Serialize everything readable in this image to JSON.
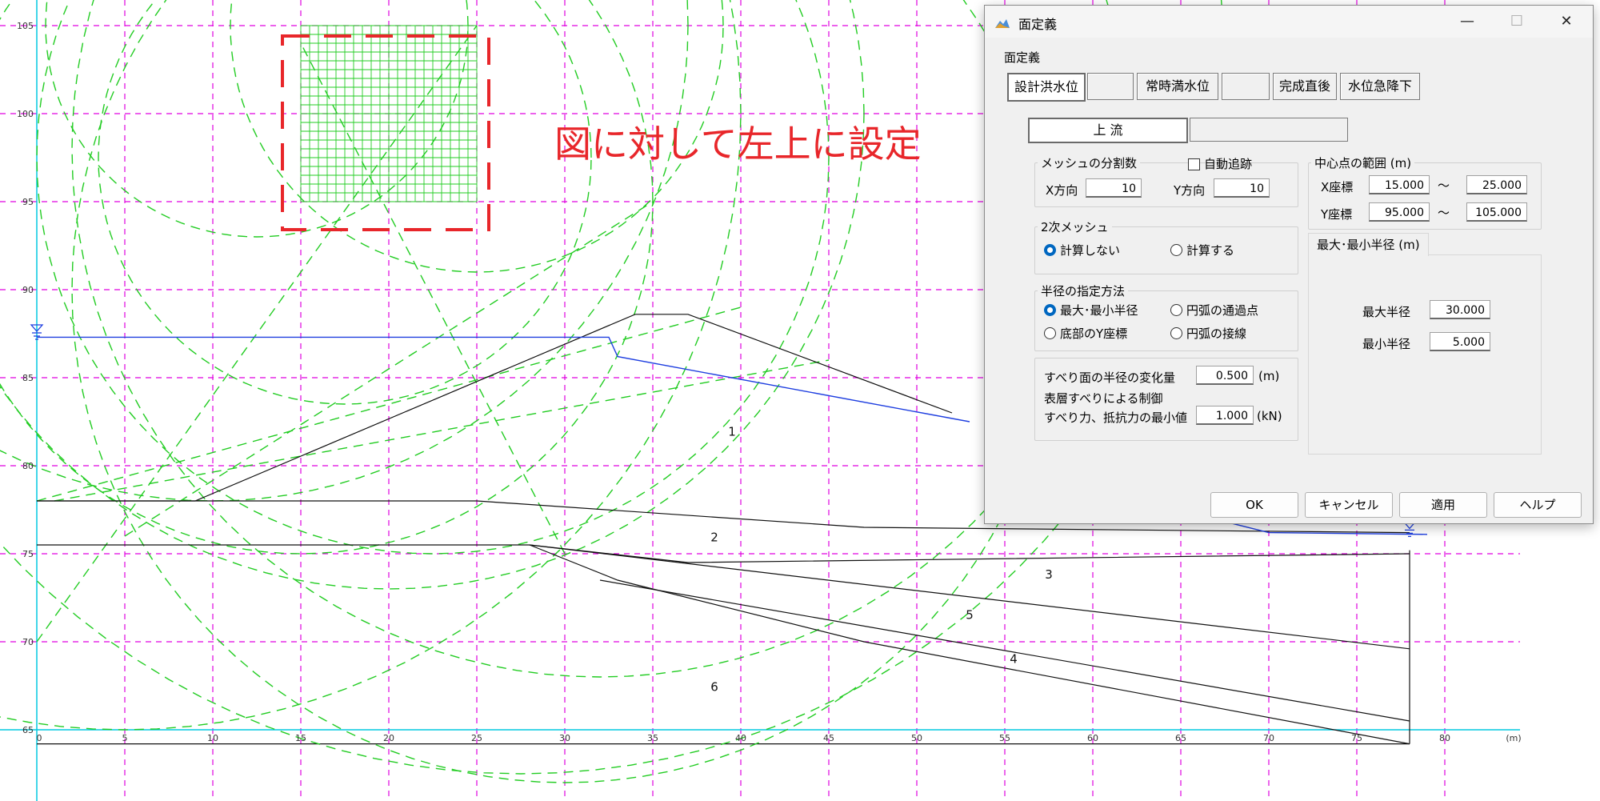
{
  "plot": {
    "y_labels": [
      "105",
      "100",
      "95",
      "90",
      "85",
      "80",
      "75",
      "70",
      "65"
    ],
    "x_labels": [
      "0",
      "5",
      "10",
      "15",
      "20",
      "25",
      "30",
      "35",
      "40",
      "45",
      "50",
      "55",
      "60",
      "65",
      "70",
      "75",
      "80"
    ],
    "x_unit": "(m)",
    "layer_labels": [
      "1",
      "2",
      "3",
      "5",
      "4",
      "6"
    ],
    "annotation": "図に対して左上に設定",
    "colors": {
      "grid": "#e000e0",
      "axis": "#00c8e0",
      "arc": "#22cc22",
      "water": "#2040e0",
      "strata": "#111111",
      "highlight": "#e8262a"
    }
  },
  "dialog": {
    "title": "面定義",
    "min_symbol": "—",
    "max_symbol": "☐",
    "close_symbol": "✕",
    "group_label": "面定義",
    "tabs": [
      "設計洪水位",
      "",
      "常時満水位",
      "",
      "完成直後",
      "水位急降下"
    ],
    "subtabs": [
      "上 流",
      ""
    ],
    "mesh": {
      "title": "メッシュの分割数",
      "auto_track": "自動追跡",
      "auto_track_checked": false,
      "x_label": "X方向",
      "x_value": "10",
      "y_label": "Y方向",
      "y_value": "10"
    },
    "center": {
      "title": "中心点の範囲 (m)",
      "x_label": "X座標",
      "x_from": "15.000",
      "x_to": "25.000",
      "y_label": "Y座標",
      "y_from": "95.000",
      "y_to": "105.000",
      "tilde": "〜"
    },
    "secondary_mesh": {
      "title": "2次メッシュ",
      "opt_off": "計算しない",
      "opt_on": "計算する",
      "selected": "計算しない"
    },
    "radius_method": {
      "title": "半径の指定方法",
      "opt1": "最大･最小半径",
      "opt2": "円弧の通過点",
      "opt3": "底部のY座標",
      "opt4": "円弧の接線",
      "selected": "最大･最小半径"
    },
    "radius_range": {
      "tab_label": "最大･最小半径 (m)",
      "max_label": "最大半径",
      "max_value": "30.000",
      "min_label": "最小半径",
      "min_value": "5.000"
    },
    "slip": {
      "increment_label": "すべり面の半径の変化量",
      "increment_value": "0.500",
      "increment_unit": "(m)",
      "control_label": "表層すべりによる制御",
      "min_force_label": "すべり力、抵抗力の最小値",
      "min_force_value": "1.000",
      "min_force_unit": "(kN)"
    },
    "buttons": {
      "ok": "OK",
      "cancel": "キャンセル",
      "apply": "適用",
      "help": "ヘルプ"
    }
  }
}
